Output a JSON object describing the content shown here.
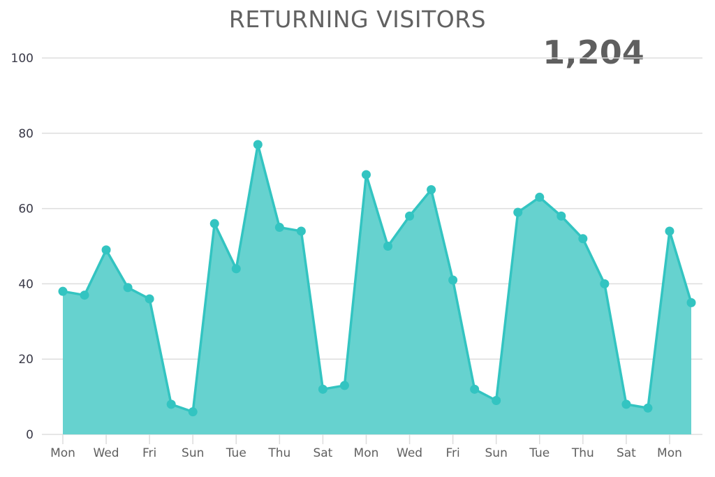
{
  "header": {
    "title": "RETURNING VISITORS",
    "total": "1,204"
  },
  "colors": {
    "area_fill": "#66d2cf",
    "line": "#33c4c1",
    "grid": "#dddddd",
    "text": "#616161"
  },
  "chart_data": {
    "type": "area",
    "title": "RETURNING VISITORS",
    "annotation": "1,204",
    "xlabel": "",
    "ylabel": "",
    "ylim": [
      0,
      100
    ],
    "yticks": [
      0,
      20,
      40,
      60,
      80,
      100
    ],
    "grid": true,
    "x_tick_labels": [
      "Mon",
      "Wed",
      "Fri",
      "Sun",
      "Tue",
      "Thu",
      "Sat",
      "Mon",
      "Wed",
      "Fri",
      "Sun",
      "Tue",
      "Thu",
      "Sat",
      "Mon"
    ],
    "x_tick_every": 2,
    "categories": [
      "Mon",
      "Tue",
      "Wed",
      "Thu",
      "Fri",
      "Sat",
      "Sun",
      "Mon",
      "Tue",
      "Wed",
      "Thu",
      "Fri",
      "Sat",
      "Sun",
      "Mon",
      "Tue",
      "Wed",
      "Thu",
      "Fri",
      "Sat",
      "Sun",
      "Mon",
      "Tue",
      "Wed",
      "Thu",
      "Fri",
      "Sat",
      "Sun",
      "Mon",
      "Tue"
    ],
    "series": [
      {
        "name": "Returning Visitors",
        "values": [
          38,
          37,
          49,
          39,
          36,
          8,
          6,
          56,
          44,
          77,
          55,
          54,
          12,
          13,
          69,
          50,
          58,
          65,
          41,
          12,
          9,
          59,
          63,
          58,
          52,
          40,
          8,
          7,
          54,
          35
        ]
      }
    ]
  }
}
